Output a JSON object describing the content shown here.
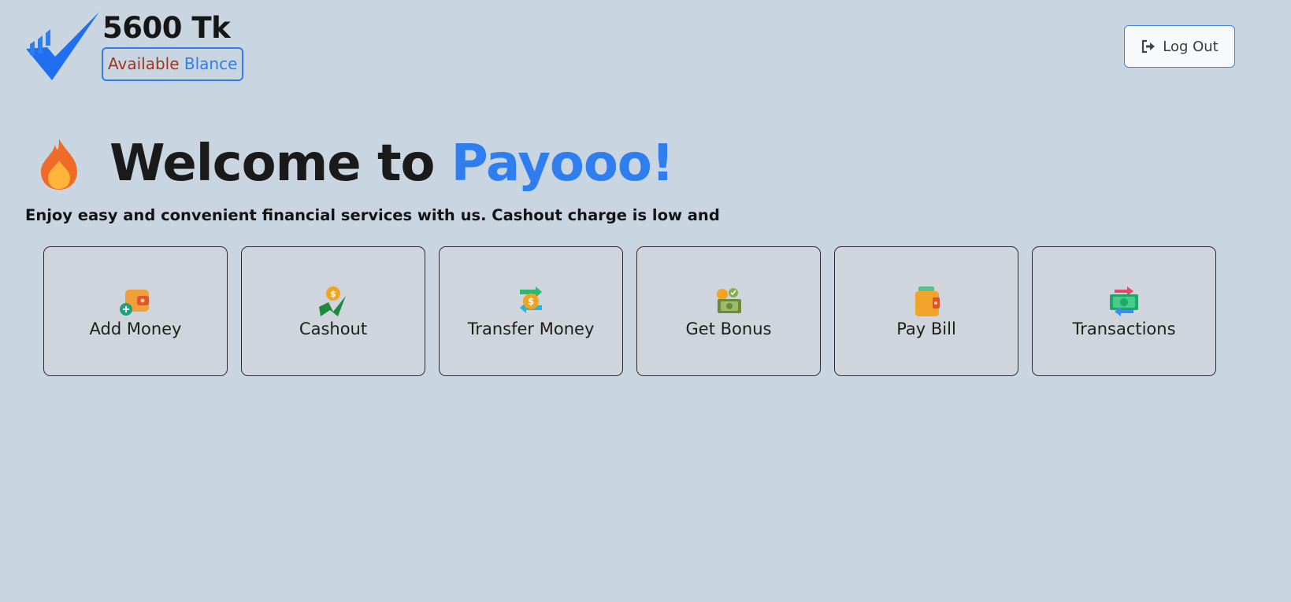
{
  "header": {
    "logo_icon": "checkmark-logo-icon",
    "balance_amount": "5600 Tk",
    "balance_label_part1": "Available",
    "balance_label_part2": "Blance",
    "logout_label": "Log Out",
    "logout_icon": "logout-icon"
  },
  "hero": {
    "icon": "fire-icon",
    "title_part1": "Welcome to",
    "title_part2": "Payooo!",
    "tagline": "Enjoy easy and convenient financial services with us. Cashout charge is low and"
  },
  "actions": [
    {
      "label": "Add Money",
      "icon": "wallet-plus-icon"
    },
    {
      "label": "Cashout",
      "icon": "cashout-coin-icon"
    },
    {
      "label": "Transfer Money",
      "icon": "transfer-coin-icon"
    },
    {
      "label": "Get Bonus",
      "icon": "bonus-cash-icon"
    },
    {
      "label": "Pay Bill",
      "icon": "wallet-bill-icon"
    },
    {
      "label": "Transactions",
      "icon": "transactions-banknote-icon"
    }
  ],
  "colors": {
    "background": "#c9d5e1",
    "accent": "#2f7ef0",
    "available_text": "#a1351c",
    "card_background": "#d0d5dd"
  }
}
